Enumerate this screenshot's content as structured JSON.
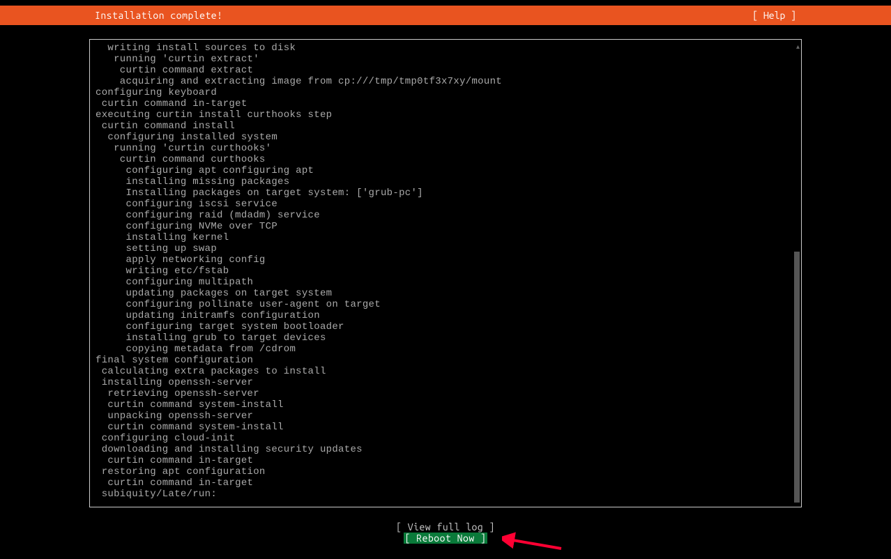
{
  "header": {
    "title": "Installation complete!",
    "help": "[ Help ]"
  },
  "log": {
    "lines": [
      "  writing install sources to disk",
      "   running 'curtin extract'",
      "    curtin command extract",
      "    acquiring and extracting image from cp:///tmp/tmp0tf3x7xy/mount",
      "configuring keyboard",
      " curtin command in-target",
      "executing curtin install curthooks step",
      " curtin command install",
      "  configuring installed system",
      "   running 'curtin curthooks'",
      "    curtin command curthooks",
      "     configuring apt configuring apt",
      "     installing missing packages",
      "     Installing packages on target system: ['grub-pc']",
      "     configuring iscsi service",
      "     configuring raid (mdadm) service",
      "     configuring NVMe over TCP",
      "     installing kernel",
      "     setting up swap",
      "     apply networking config",
      "     writing etc/fstab",
      "     configuring multipath",
      "     updating packages on target system",
      "     configuring pollinate user-agent on target",
      "     updating initramfs configuration",
      "     configuring target system bootloader",
      "     installing grub to target devices",
      "     copying metadata from /cdrom",
      "final system configuration",
      " calculating extra packages to install",
      " installing openssh-server",
      "  retrieving openssh-server",
      "  curtin command system-install",
      "  unpacking openssh-server",
      "  curtin command system-install",
      " configuring cloud-init",
      " downloading and installing security updates",
      "  curtin command in-target",
      " restoring apt configuration",
      "  curtin command in-target",
      " subiquity/Late/run:"
    ]
  },
  "footer": {
    "view_full_log": "[ View full log ]",
    "reboot_now": "[ Reboot Now     ]"
  },
  "colors": {
    "header_bg": "#e95420",
    "reboot_bg": "#0a7a3a",
    "arrow": "#ff0033"
  }
}
